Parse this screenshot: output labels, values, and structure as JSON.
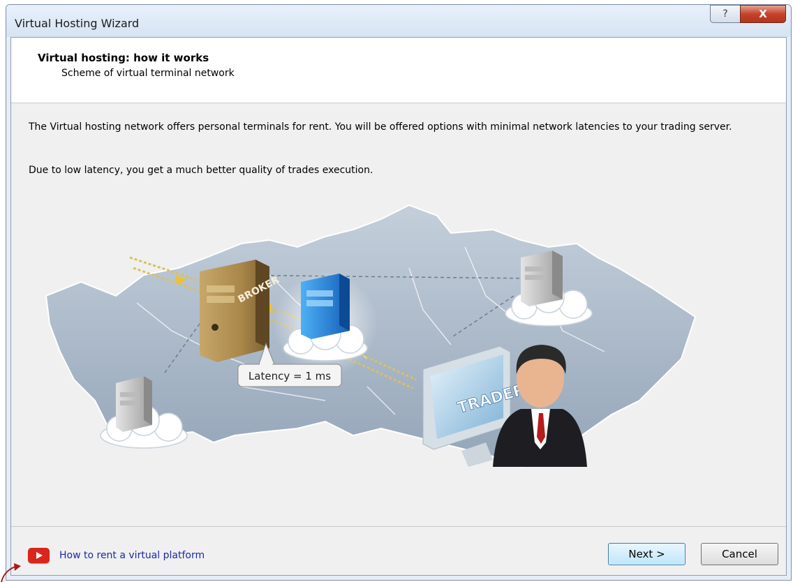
{
  "window": {
    "title": "Virtual Hosting Wizard",
    "help_label": "?",
    "close_label": "X"
  },
  "header": {
    "title": "Virtual hosting: how it works",
    "subtitle": "Scheme of virtual terminal network"
  },
  "body": {
    "paragraph1": "The Virtual hosting network offers personal terminals for rent. You will be offered options with minimal network latencies to your trading server.",
    "paragraph2": "Due to low latency, you get a much better quality of trades execution."
  },
  "diagram": {
    "broker_label": "BROKER",
    "trader_label": "TRADER",
    "latency_label": "Latency = 1 ms"
  },
  "footer": {
    "video_link": "How to rent a virtual platform",
    "next_label": "Next >",
    "cancel_label": "Cancel"
  },
  "icons": {
    "video": "youtube-play-icon",
    "help": "question-mark-icon",
    "close": "close-x-icon"
  },
  "colors": {
    "link": "#1a2ba8",
    "video_icon": "#d9261c",
    "close_button": "#c4432b",
    "accent_server": "#1f7fd6"
  }
}
